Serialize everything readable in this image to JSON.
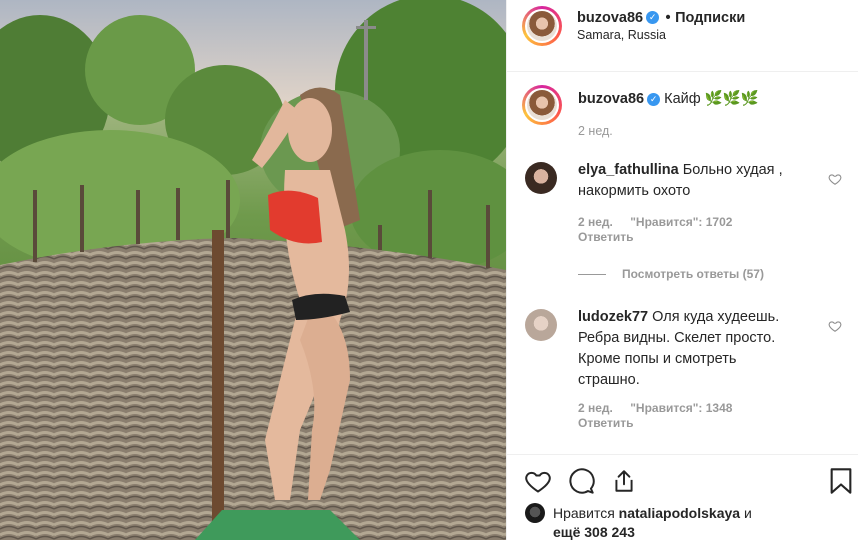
{
  "post_header": {
    "username": "buzova86",
    "verified_mark": "✓",
    "separator": "•",
    "follow_label": "Подписки",
    "location": "Samara, Russia"
  },
  "caption": {
    "username": "buzova86",
    "text": "Кайф 🌿🌿🌿",
    "time": "2 нед."
  },
  "comments": [
    {
      "username": "elya_fathullina",
      "text_line1": "Больно худая ,",
      "text_line2": "накормить охото",
      "time": "2 нед.",
      "likes": "\"Нравится\": 1702",
      "reply_label": "Ответить",
      "view_replies": "Посмотреть ответы (57)"
    },
    {
      "username": "ludozek77",
      "text_line1": "Оля куда худеешь.",
      "text_line2": "Ребра видны. Скелет просто.",
      "text_line3": "Кроме попы и смотреть",
      "text_line4": "страшно.",
      "time": "2 нед.",
      "likes": "\"Нравится\": 1348",
      "reply_label": "Ответить"
    }
  ],
  "likes_line": {
    "prefix": "Нравится",
    "user": "nataliapodolskaya",
    "conj": "и",
    "others": "ещё 308 243"
  },
  "icons": [
    "heart-icon",
    "comment-icon",
    "share-icon",
    "bookmark-icon",
    "verified-icon"
  ],
  "colors": {
    "verified": "#3897f0",
    "meta_gray": "#999999",
    "text": "#262626"
  }
}
